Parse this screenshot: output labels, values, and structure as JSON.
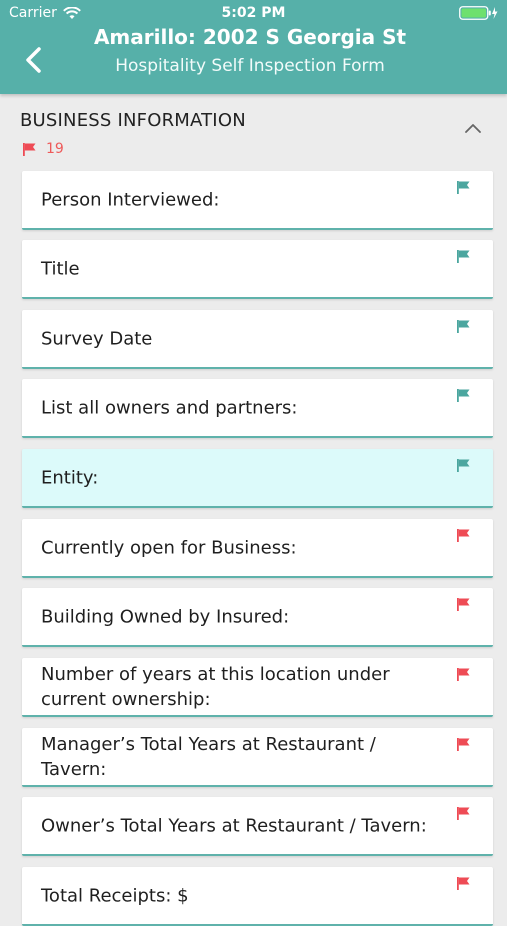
{
  "status_bar": {
    "carrier": "Carrier",
    "time": "5:02 PM"
  },
  "nav": {
    "title": "Amarillo: 2002 S Georgia St",
    "subtitle": "Hospitality Self Inspection Form"
  },
  "section": {
    "title": "BUSINESS INFORMATION",
    "count": "19",
    "collapse_icon": "chevron-up-icon"
  },
  "colors": {
    "header": "#56b0a9",
    "flag_answered": "#4ba69f",
    "flag_pending": "#ee4b55",
    "active_card": "#dcfafa"
  },
  "items": [
    {
      "label": "Person Interviewed:",
      "flag": "teal"
    },
    {
      "label": "Title",
      "flag": "teal"
    },
    {
      "label": "Survey Date",
      "flag": "teal"
    },
    {
      "label": "List all owners and partners:",
      "flag": "teal"
    },
    {
      "label": "Entity:",
      "flag": "teal",
      "active": true
    },
    {
      "label": "Currently open for Business:",
      "flag": "red"
    },
    {
      "label": "Building Owned by Insured:",
      "flag": "red"
    },
    {
      "label": "Number of years at this location under current ownership:",
      "flag": "red"
    },
    {
      "label": "Manager’s Total Years at Restaurant / Tavern:",
      "flag": "red"
    },
    {
      "label": "Owner’s Total Years at Restaurant / Tavern:",
      "flag": "red"
    },
    {
      "label": "Total Receipts: $",
      "flag": "red"
    }
  ]
}
